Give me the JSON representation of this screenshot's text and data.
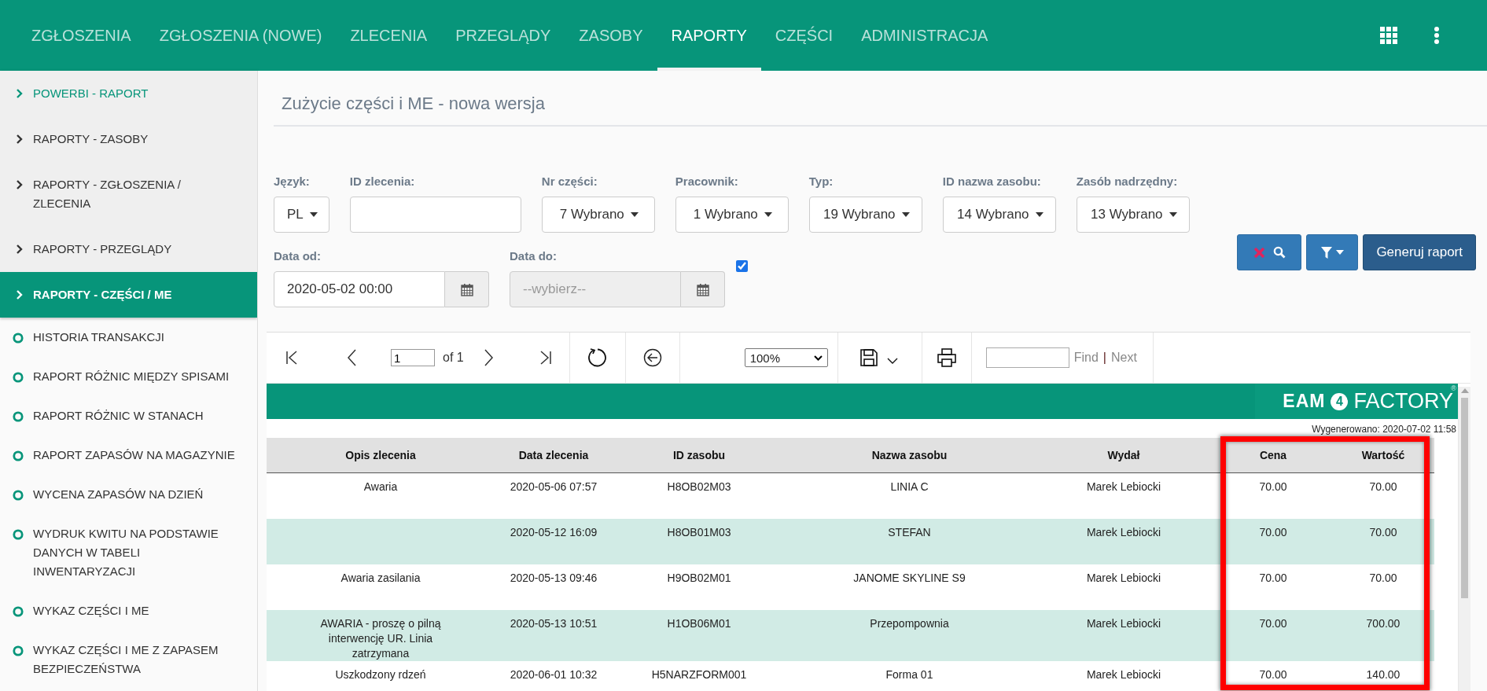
{
  "nav": {
    "tabs": [
      {
        "label": "ZGŁOSZENIA",
        "selected": false
      },
      {
        "label": "ZGŁOSZENIA (NOWE)",
        "selected": false
      },
      {
        "label": "ZLECENIA",
        "selected": false
      },
      {
        "label": "PRZEGLĄDY",
        "selected": false
      },
      {
        "label": "ZASOBY",
        "selected": false
      },
      {
        "label": "RAPORTY",
        "selected": true
      },
      {
        "label": "CZĘŚCI",
        "selected": false
      },
      {
        "label": "ADMINISTRACJA",
        "selected": false
      }
    ]
  },
  "sidebar": {
    "items": [
      {
        "label": "POWERBI - RAPORT",
        "kind": "group",
        "selected": false,
        "hovered": true
      },
      {
        "label": "RAPORTY - ZASOBY",
        "kind": "group",
        "selected": false,
        "hovered": false
      },
      {
        "label": "RAPORTY - ZGŁOSZENIA / ZLECENIA",
        "kind": "group",
        "selected": false,
        "hovered": false
      },
      {
        "label": "RAPORTY - PRZEGLĄDY",
        "kind": "group",
        "selected": false,
        "hovered": false
      },
      {
        "label": "RAPORTY - CZĘŚCI / ME",
        "kind": "group",
        "selected": true,
        "hovered": false
      },
      {
        "label": "HISTORIA TRANSAKCJI",
        "kind": "report",
        "selected": false,
        "hovered": false
      },
      {
        "label": "RAPORT RÓŻNIC MIĘDZY SPISAMI",
        "kind": "report",
        "selected": false,
        "hovered": false
      },
      {
        "label": "RAPORT RÓŻNIC W STANACH",
        "kind": "report",
        "selected": false,
        "hovered": false
      },
      {
        "label": "RAPORT ZAPASÓW NA MAGAZYNIE",
        "kind": "report",
        "selected": false,
        "hovered": false
      },
      {
        "label": "WYCENA ZAPASÓW NA DZIEŃ",
        "kind": "report",
        "selected": false,
        "hovered": false
      },
      {
        "label": "WYDRUK KWITU NA PODSTAWIE DANYCH W TABELI INWENTARYZACJI",
        "kind": "report",
        "selected": false,
        "hovered": false
      },
      {
        "label": "WYKAZ CZĘŚCI I ME",
        "kind": "report",
        "selected": false,
        "hovered": false
      },
      {
        "label": "WYKAZ CZĘŚCI I ME Z ZAPASEM BEZPIECZEŃSTWA",
        "kind": "report",
        "selected": false,
        "hovered": false
      }
    ]
  },
  "page": {
    "title": "Zużycie części i ME - nowa wersja"
  },
  "filters": {
    "fields": [
      {
        "label": "Język:",
        "kind": "dropdown",
        "value": "PL"
      },
      {
        "label": "ID zlecenia:",
        "kind": "text"
      },
      {
        "label": "Nr części:",
        "kind": "dropdown",
        "value": "7 Wybrano"
      },
      {
        "label": "Pracownik:",
        "kind": "dropdown",
        "value": "1 Wybrano"
      },
      {
        "label": "Typ:",
        "kind": "dropdown",
        "value": "19 Wybrano"
      },
      {
        "label": "ID nazwa zasobu:",
        "kind": "dropdown",
        "value": "14 Wybrano"
      },
      {
        "label": "Zasób nadrzędny:",
        "kind": "dropdown",
        "value": "13 Wybrano"
      }
    ],
    "dates": [
      {
        "label": "Data od:",
        "value": "2020-05-02 00:00",
        "disabled": false
      },
      {
        "label": "Data do:",
        "placeholder": "--wybierz--",
        "disabled": true
      }
    ],
    "date_to_checkbox": {
      "checked": true
    },
    "buttons": [
      {
        "kind": "clear-search"
      },
      {
        "kind": "filter-menu"
      },
      {
        "kind": "primary",
        "label": "Generuj raport"
      }
    ]
  },
  "report_viewer": {
    "toolbar": {
      "page": "1",
      "page_count": "of 1",
      "zoom": "100%",
      "find_label": "Find",
      "separator": "|",
      "next_label": "Next"
    },
    "logo": {
      "left": "EAM",
      "mark": "4",
      "right": "FACTORY",
      "registered": "®"
    },
    "generated": "Wygenerowano: 2020-07-02 11:58",
    "table": {
      "columns": [
        {
          "label": "Opis zlecenia",
          "highlighted": false
        },
        {
          "label": "Data zlecenia",
          "highlighted": false
        },
        {
          "label": "ID zasobu",
          "highlighted": false
        },
        {
          "label": "Nazwa zasobu",
          "highlighted": false
        },
        {
          "label": "Wydał",
          "highlighted": false
        },
        {
          "label": "Cena",
          "highlighted": true
        },
        {
          "label": "Wartość",
          "highlighted": true
        }
      ],
      "rows": [
        [
          "Awaria",
          "2020-05-06 07:57",
          "H8OB02M03",
          "LINIA C",
          "Marek Lebiocki",
          "70.00",
          "70.00"
        ],
        [
          null,
          "2020-05-12 16:09",
          "H8OB01M03",
          "STEFAN",
          "Marek Lebiocki",
          "70.00",
          "70.00"
        ],
        [
          "Awaria zasilania",
          "2020-05-13 09:46",
          "H9OB02M01",
          "JANOME SKYLINE S9",
          "Marek Lebiocki",
          "70.00",
          "70.00"
        ],
        [
          "AWARIA - proszę o pilną interwencję UR. Linia zatrzymana",
          "2020-05-13 10:51",
          "H1OB06M01",
          "Przepompownia",
          "Marek Lebiocki",
          "70.00",
          "700.00"
        ],
        [
          "Uszkodzony rdzeń",
          "2020-06-01 10:32",
          "H5NARZFORM001",
          "Forma 01",
          "Marek Lebiocki",
          "70.00",
          "140.00"
        ]
      ]
    }
  }
}
